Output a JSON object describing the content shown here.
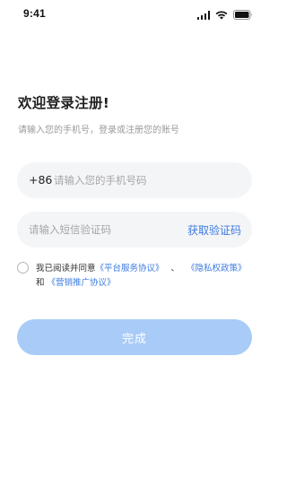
{
  "status_bar": {
    "time": "9:41",
    "icons": [
      "signal-icon",
      "wifi-icon",
      "battery-icon"
    ]
  },
  "header": {
    "title": "欢迎登录注册!",
    "subtitle": "请输入您的手机号，登录或注册您的账号"
  },
  "phone": {
    "country_code": "+86",
    "value": "",
    "placeholder": "请输入您的手机号码"
  },
  "sms_code": {
    "value": "",
    "placeholder": "请输入短信验证码",
    "get_code_label": "获取验证码"
  },
  "agreement": {
    "checked": false,
    "prefix": "我已阅读并同意",
    "service_link": "《平台服务协议》",
    "separator": "、",
    "privacy_link": "《隐私权政策》",
    "conjunction": "和",
    "marketing_link": "《营销推广协议》"
  },
  "submit": {
    "label": "完成",
    "enabled": false
  },
  "colors": {
    "accent": "#3d7be0",
    "button_disabled": "#a8ccf7",
    "field_background": "#f4f5f7",
    "placeholder": "#a6a6a6",
    "subtitle": "#9a9a9a"
  }
}
